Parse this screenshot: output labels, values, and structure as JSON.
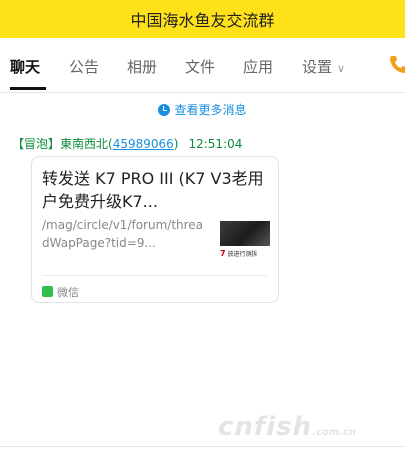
{
  "window": {
    "title": "中国海水鱼友交流群"
  },
  "tabs": [
    {
      "label": "聊天"
    },
    {
      "label": "公告"
    },
    {
      "label": "相册"
    },
    {
      "label": "文件"
    },
    {
      "label": "应用"
    },
    {
      "label": "设置"
    }
  ],
  "history": {
    "label": "查看更多消息"
  },
  "message": {
    "sender_tag": "【冒泡】",
    "sender_name": "東南西北",
    "paren_open": "(",
    "qq": "45989066",
    "paren_close": ")",
    "time": "12:51:04",
    "card": {
      "title": "转发送 K7 PRO III (K7 V3老用户免费升级K7...",
      "url": "/mag/circle/v1/forum/threadWapPage?tid=9...",
      "source": "微信",
      "thumb_caption": "放进行测拆"
    }
  },
  "watermark": {
    "brand": "cnfish",
    "domain": ".com.cn"
  },
  "colors": {
    "title_bar": "#ffe11a",
    "link_blue": "#1a8fe0",
    "sender_green": "#0a8a3a",
    "wechat_green": "#2fbf4a"
  }
}
